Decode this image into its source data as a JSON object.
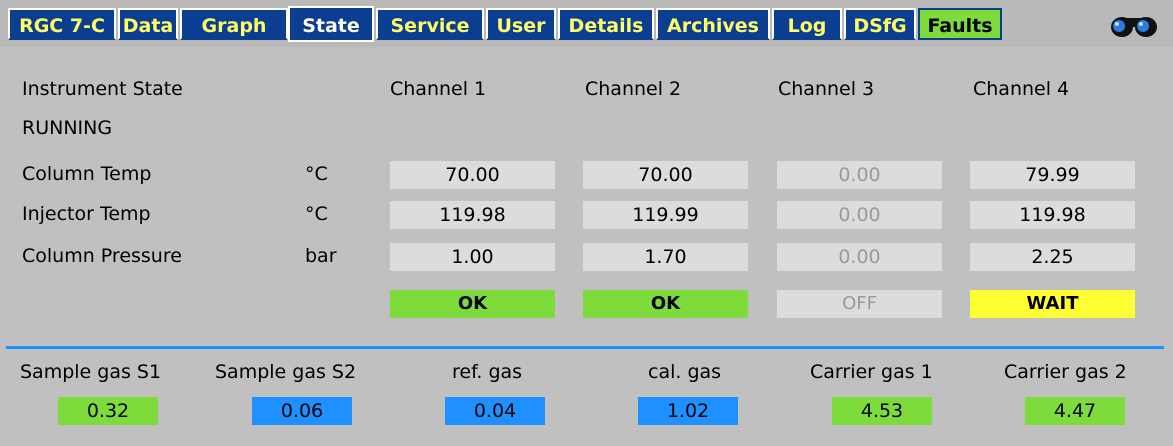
{
  "tabs": [
    {
      "label": "RGC 7-C"
    },
    {
      "label": "Data"
    },
    {
      "label": "Graph"
    },
    {
      "label": "State"
    },
    {
      "label": "Service"
    },
    {
      "label": "User"
    },
    {
      "label": "Details"
    },
    {
      "label": "Archives"
    },
    {
      "label": "Log"
    },
    {
      "label": "DSfG"
    },
    {
      "label": "Faults"
    }
  ],
  "active_tab": "State",
  "header_icon": "binoculars-icon",
  "instrument": {
    "title": "Instrument State",
    "state": "RUNNING"
  },
  "channels": [
    "Channel 1",
    "Channel 2",
    "Channel 3",
    "Channel 4"
  ],
  "rows": [
    {
      "label": "Column Temp",
      "unit": "°C",
      "values": [
        "70.00",
        "70.00",
        "0.00",
        "79.99"
      ]
    },
    {
      "label": "Injector Temp",
      "unit": "°C",
      "values": [
        "119.98",
        "119.99",
        "0.00",
        "119.98"
      ]
    },
    {
      "label": "Column Pressure",
      "unit": "bar",
      "values": [
        "1.00",
        "1.70",
        "0.00",
        "2.25"
      ]
    }
  ],
  "statuses": [
    {
      "text": "OK",
      "color": "#7ddc3b"
    },
    {
      "text": "OK",
      "color": "#7ddc3b"
    },
    {
      "text": "OFF",
      "color": "#dcdcdc"
    },
    {
      "text": "WAIT",
      "color": "#ffff33"
    }
  ],
  "gases": [
    {
      "label": "Sample gas S1",
      "value": "0.32",
      "color": "#7ddc3b"
    },
    {
      "label": "Sample gas S2",
      "value": "0.06",
      "color": "#1e90ff"
    },
    {
      "label": "ref. gas",
      "value": "0.04",
      "color": "#1e90ff"
    },
    {
      "label": "cal. gas",
      "value": "1.02",
      "color": "#1e90ff"
    },
    {
      "label": "Carrier gas 1",
      "value": "4.53",
      "color": "#7ddc3b"
    },
    {
      "label": "Carrier gas 2",
      "value": "4.47",
      "color": "#7ddc3b"
    }
  ],
  "colors": {
    "tab_bg": "#0b3d91",
    "tab_text": "#ffff66",
    "background": "#c0c0c0",
    "ok": "#7ddc3b",
    "wait": "#ffff33",
    "blue": "#1e90ff"
  }
}
